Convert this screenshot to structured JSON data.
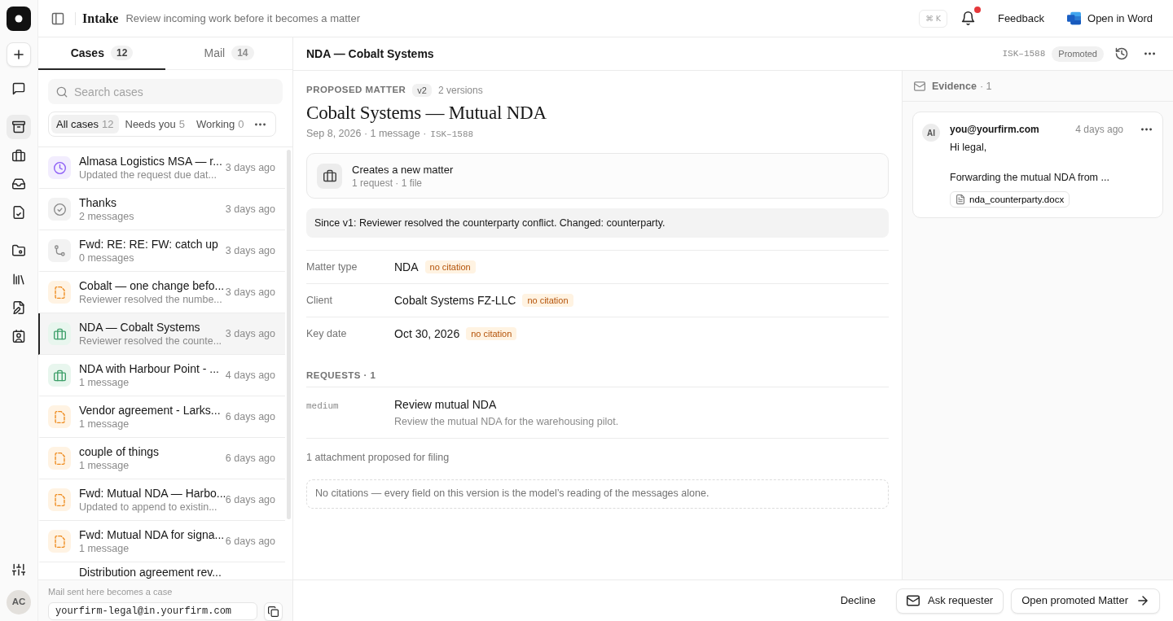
{
  "rail": {
    "groups": [
      [
        {
          "kind": "chat",
          "selected": false
        }
      ],
      [
        {
          "kind": "archive",
          "selected": true
        },
        {
          "kind": "briefcase",
          "selected": false
        },
        {
          "kind": "inbox",
          "selected": false
        },
        {
          "kind": "review",
          "selected": false
        }
      ],
      [
        {
          "kind": "folder",
          "selected": false
        },
        {
          "kind": "library",
          "selected": false
        },
        {
          "kind": "edit",
          "selected": false
        },
        {
          "kind": "contact",
          "selected": false
        }
      ]
    ],
    "user": {
      "initials": "AC"
    }
  },
  "topbar": {
    "title": "Intake",
    "subtitle": "Review incoming work before it becomes a matter",
    "shortcut": "⌘ K",
    "notifications": {
      "unread": true
    },
    "actions": [
      {
        "kind": "feedback",
        "label": "Feedback"
      },
      {
        "kind": "word",
        "label": "Open in Word"
      }
    ]
  },
  "cases_panel": {
    "tabs": [
      {
        "label": "Cases",
        "count": "12",
        "selected": true
      },
      {
        "label": "Mail",
        "count": "14",
        "selected": false
      }
    ],
    "search": {
      "placeholder": "Search cases"
    },
    "filters": [
      {
        "label": "All cases",
        "count": "12",
        "selected": true
      },
      {
        "label": "Needs you",
        "count": "5",
        "selected": false
      },
      {
        "label": "Working",
        "count": "0",
        "selected": false
      }
    ],
    "items": [
      {
        "kind": "scheduled",
        "title": "Almasa Logistics MSA — r...",
        "subtitle": "Updated the request due dat...",
        "time": "3 days ago",
        "selected": false
      },
      {
        "kind": "resolved",
        "title": "Thanks",
        "subtitle": "2 messages",
        "time": "3 days ago",
        "selected": false
      },
      {
        "kind": "thread",
        "title": "Fwd: RE: RE: FW: catch up",
        "subtitle": "0 messages",
        "time": "3 days ago",
        "selected": false
      },
      {
        "kind": "draft",
        "title": "Cobalt — one change befo...",
        "subtitle": "Reviewer resolved the numbe...",
        "time": "3 days ago",
        "selected": false
      },
      {
        "kind": "matter",
        "title": "NDA — Cobalt Systems",
        "subtitle": "Reviewer resolved the counte...",
        "time": "3 days ago",
        "selected": true
      },
      {
        "kind": "matter",
        "title": "NDA with Harbour Point - ...",
        "subtitle": "1 message",
        "time": "4 days ago",
        "selected": false
      },
      {
        "kind": "draft",
        "title": "Vendor agreement - Larks...",
        "subtitle": "1 message",
        "time": "6 days ago",
        "selected": false
      },
      {
        "kind": "draft",
        "title": "couple of things",
        "subtitle": "1 message",
        "time": "6 days ago",
        "selected": false
      },
      {
        "kind": "draft",
        "title": "Fwd: Mutual NDA — Harbo...",
        "subtitle": "Updated to append to existin...",
        "time": "6 days ago",
        "selected": false
      },
      {
        "kind": "draft",
        "title": "Fwd: Mutual NDA for signa...",
        "subtitle": "1 message",
        "time": "6 days ago",
        "selected": false
      },
      {
        "title": "Distribution agreement rev...",
        "selected": false
      }
    ],
    "footer": {
      "hint": "Mail sent here becomes a case",
      "address": "yourfirm-legal@in.yourfirm.com"
    }
  },
  "detail": {
    "header": {
      "title": "NDA — Cobalt Systems",
      "reference": "ISK–1588",
      "status": "Promoted"
    },
    "eyebrow": "PROPOSED MATTER",
    "version": "v2",
    "versions": "2 versions",
    "title": "Cobalt Systems — Mutual NDA",
    "meta": "Sep 8, 2026 · 1 message ·",
    "reference": "ISK–1588",
    "summary": {
      "title": "Creates a new matter",
      "detail": "1 request · 1 file"
    },
    "change_note": "Since v1: Reviewer resolved the counterparty conflict. Changed: counterparty.",
    "fields": [
      {
        "label": "Matter type",
        "value": "NDA",
        "citation": "no citation"
      },
      {
        "label": "Client",
        "value": "Cobalt Systems FZ-LLC",
        "citation": "no citation"
      },
      {
        "label": "Key date",
        "value": "Oct 30, 2026",
        "citation": "no citation"
      }
    ],
    "requests_heading": "REQUESTS · 1",
    "requests": [
      {
        "priority": "medium",
        "title": "Review mutual NDA",
        "description": "Review the mutual NDA for the warehousing pilot."
      }
    ],
    "attachments_note": "1 attachment proposed for filing",
    "citations_note": "No citations — every field on this version is the model’s reading of the messages alone."
  },
  "evidence": {
    "title": "Evidence",
    "count": "· 1",
    "messages": [
      {
        "avatar": "AI",
        "sender": "you@yourfirm.com",
        "time": "4 days ago",
        "body": "Hi legal,\n\nForwarding the mutual NDA from ...",
        "attachments": [
          "nda_counterparty.docx"
        ]
      }
    ]
  },
  "actions": [
    {
      "kind": "decline",
      "label": "Decline"
    },
    {
      "kind": "ask",
      "label": "Ask requester"
    },
    {
      "kind": "open",
      "label": "Open promoted Matter"
    }
  ]
}
